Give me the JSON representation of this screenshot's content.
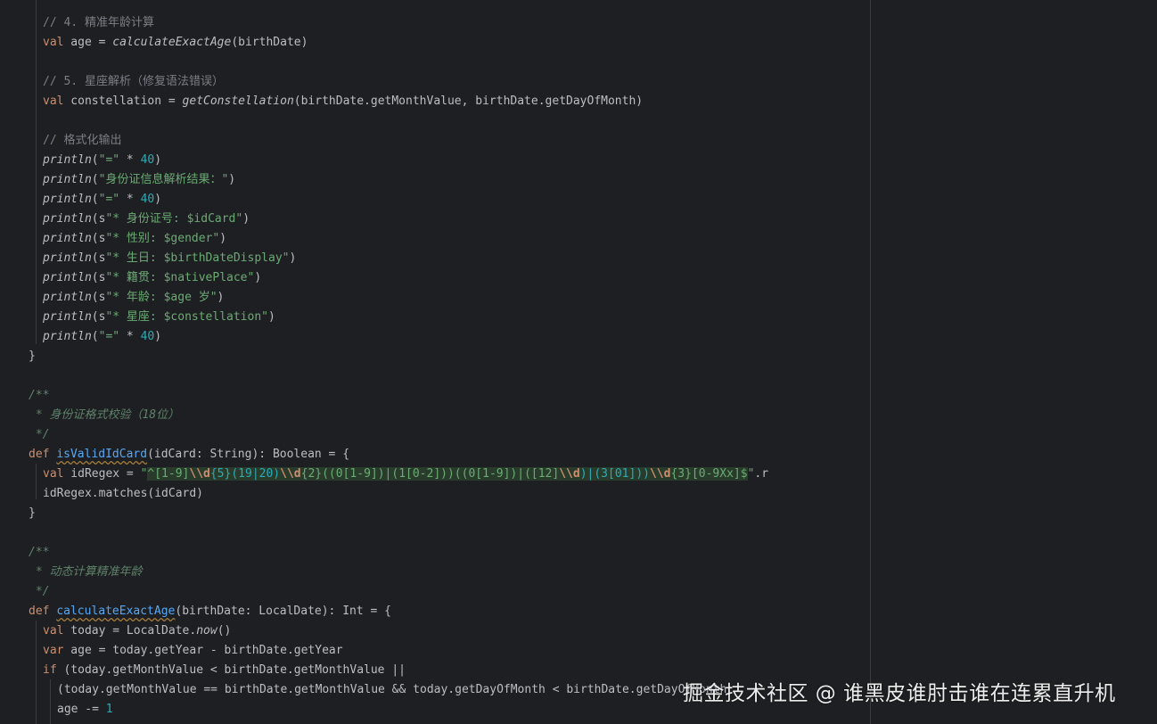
{
  "lines": {
    "l1": "// 4. 精准年龄计算",
    "l2_kw": "val",
    "l2_a": " age = ",
    "l2_fn": "calculateExactAge",
    "l2_b": "(birthDate)",
    "l3": "// 5. 星座解析（修复语法错误）",
    "l4_kw": "val",
    "l4_a": " constellation = ",
    "l4_fn": "getConstellation",
    "l4_b": "(birthDate.getMonthValue, birthDate.getDayOfMonth)",
    "l5": "// 格式化输出",
    "p_fn": "println",
    "p_open": "(",
    "p_eq": "\"=\"",
    "p_mul": " * ",
    "p_40": "40",
    "p_close": ")",
    "p2_str": "\"身份证信息解析结果：\"",
    "p_s": "s",
    "p4_str": "\"* 身份证号: $idCard\"",
    "p5_str": "\"* 性别: $gender\"",
    "p6_str": "\"* 生日: $birthDateDisplay\"",
    "p7_str": "\"* 籍贯: $nativePlace\"",
    "p8_str": "\"* 年龄: $age 岁\"",
    "p9_str": "\"* 星座: $constellation\"",
    "brace_close": "}",
    "doc_open": "/**",
    "doc1": " * 身份证格式校验（18位）",
    "doc_close": " */",
    "def_kw": "def",
    "fn1_name": "isValidIdCard",
    "fn1_sig": "(idCard: String): Boolean = {",
    "r_kw": "val",
    "r_a": " idRegex = ",
    "r_q": "\"",
    "r_1": "^[1-9]",
    "r_esc1": "\\\\d",
    "r_2": "{5}(19|20)",
    "r_esc2": "\\\\d",
    "r_3": "{2}((0[1-9])|(1[0-2]))((0[1-9])|([12]",
    "r_esc3": "\\\\d",
    "r_4": ")|(3[01]))",
    "r_esc4": "\\\\d",
    "r_5": "{3}[0-9Xx]$",
    "r_q2": "\"",
    "r_tail": ".r",
    "m_line": "idRegex.matches(idCard)",
    "doc2": " * 动态计算精准年龄",
    "fn2_name": "calculateExactAge",
    "fn2_sig": "(birthDate: LocalDate): Int = {",
    "t_kw": "val",
    "t_a": " today = LocalDate.",
    "t_now": "now",
    "t_b": "()",
    "v_kw": "var",
    "v_a": " age = today.getYear - birthDate.getYear",
    "if_kw": "if",
    "if_a": " (today.getMonthValue < birthDate.getMonthValue ||",
    "c_line": "(today.getMonthValue == birthDate.getMonthValue && today.getDayOfMonth < birthDate.getDayOfMonth",
    "a_line_a": "age -= ",
    "a_line_num": "1"
  },
  "watermark": "掘金技术社区 @ 谁黑皮谁肘击谁在连累直升机",
  "colors": {
    "background": "#1e1f22",
    "keyword": "#cf8e6d",
    "comment": "#7a7e85",
    "doc_comment": "#5f826b",
    "string": "#6aab73",
    "number": "#2aacb8",
    "function_def": "#56a8f5",
    "text": "#bcbec4"
  }
}
